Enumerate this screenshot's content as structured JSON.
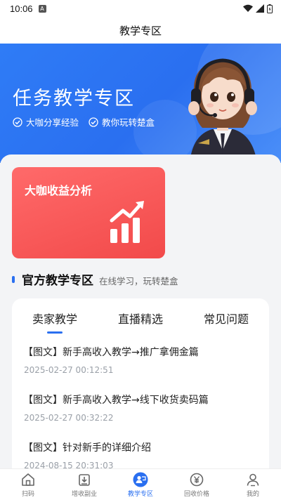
{
  "status": {
    "time": "10:06",
    "notif_glyph": "A"
  },
  "nav": {
    "title": "教学专区"
  },
  "banner": {
    "title": "任务教学专区",
    "tags": [
      "大咖分享经验",
      "教你玩转楚盒"
    ]
  },
  "promo_card": {
    "title": "大咖收益分析"
  },
  "section": {
    "title": "官方教学专区",
    "subtitle": "在线学习，玩转楚盒"
  },
  "tabs": [
    {
      "label": "卖家教学",
      "active": true
    },
    {
      "label": "直播精选",
      "active": false
    },
    {
      "label": "常见问题",
      "active": false
    }
  ],
  "articles": [
    {
      "title": "【图文】新手高收入教学→推广拿佣金篇",
      "time": "2025-02-27 00:12:51"
    },
    {
      "title": "【图文】新手高收入教学→线下收货卖码篇",
      "time": "2025-02-27 00:32:22"
    },
    {
      "title": "【图文】针对新手的详细介绍",
      "time": "2024-08-15 20:31:03"
    }
  ],
  "bottom_nav": [
    {
      "label": "扫码",
      "icon": "home-icon",
      "active": false
    },
    {
      "label": "增收副业",
      "icon": "download-box-icon",
      "active": false
    },
    {
      "label": "教学专区",
      "icon": "teach-icon",
      "active": true
    },
    {
      "label": "回收价格",
      "icon": "yen-icon",
      "active": false
    },
    {
      "label": "我的",
      "icon": "user-icon",
      "active": false
    }
  ],
  "colors": {
    "brand_blue": "#2a6ff0",
    "promo_red": "#f24a4a",
    "muted": "#9aa0a8"
  }
}
